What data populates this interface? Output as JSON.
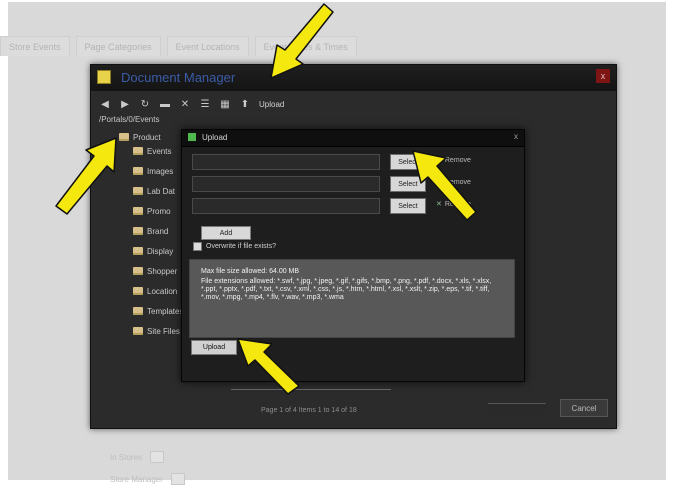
{
  "background": {
    "tabs": [
      "Store Events",
      "Page Categories",
      "Event Locations",
      "Event Dates & Times"
    ],
    "bottom_rows": [
      "In Stores",
      "Store Manager"
    ]
  },
  "document_manager": {
    "title": "Document Manager",
    "close_glyph": "x",
    "path": "/Portals/0/Events",
    "toolbar": {
      "upload_label": "Upload"
    },
    "tree_items": [
      "Product",
      "Events",
      "Images",
      "Lab Dat",
      "Promo",
      "Brand",
      "Display",
      "Shopper",
      "Location",
      "Templates",
      "Site Files"
    ],
    "pager_text": "Page 1 of 4  Items 1 to 14 of 18",
    "ok_label": "Cancel"
  },
  "upload_dialog": {
    "title": "Upload",
    "close_glyph": "x",
    "rows": [
      {
        "select_label": "Select",
        "remove_label": "Remove"
      },
      {
        "select_label": "Select",
        "remove_label": "Remove"
      },
      {
        "select_label": "Select",
        "remove_label": "Remove"
      }
    ],
    "add_label": "Add",
    "overwrite_label": "Overwrite if file exists?",
    "info": {
      "max_size": "Max file size allowed: 64.00 MB",
      "extensions": "File extensions allowed: *.swf, *.jpg, *.jpeg, *.gif, *.gifs, *.bmp, *.png, *.pdf, *.docx, *.xls, *.xlsx, *.ppt, *.pptx, *.pdf, *.txt, *.csv, *.xml, *.css, *.js, *.htm, *.html, *.xsl, *.xslt, *.zip, *.eps, *.tif, *.tiff, *.mov, *.mpg, *.mp4, *.flv, *.wav, *.mp3, *.wma"
    },
    "upload_label": "Upload"
  },
  "colors": {
    "arrow": "#f5e80f",
    "window_bg": "#2b2b2b",
    "dialog_bg": "#1e1e1e"
  }
}
